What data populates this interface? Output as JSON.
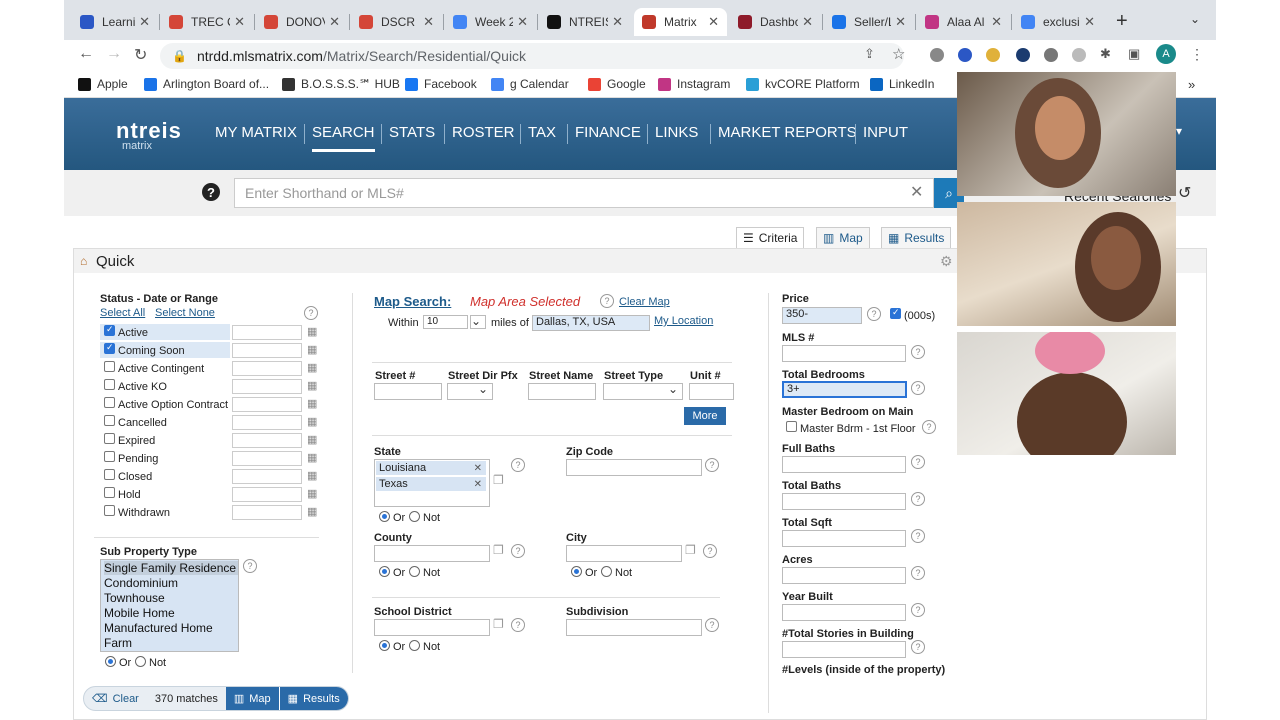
{
  "browser": {
    "tabs": [
      {
        "label": "Learnin",
        "color": "#2b57c5",
        "active": false
      },
      {
        "label": "TREC C",
        "color": "#d44638",
        "active": false
      },
      {
        "label": "DONOV",
        "color": "#d44638",
        "active": false
      },
      {
        "label": "DSCR F",
        "color": "#d44638",
        "active": false
      },
      {
        "label": "Week 2",
        "color": "#4285f4",
        "active": false
      },
      {
        "label": "NTREIS",
        "color": "#111111",
        "active": false
      },
      {
        "label": "Matrix",
        "color": "#c0392b",
        "active": true
      },
      {
        "label": "Dashbo",
        "color": "#8e1b2a",
        "active": false
      },
      {
        "label": "Seller/L",
        "color": "#1a73e8",
        "active": false
      },
      {
        "label": "Alaa Al",
        "color": "#c13584",
        "active": false
      },
      {
        "label": "exclusi",
        "color": "#4285f4",
        "active": false
      }
    ],
    "url_host": "ntrdd.mlsmatrix.com",
    "url_path": "/Matrix/Search/Residential/Quick",
    "profile_initial": "A",
    "bookmarks": [
      {
        "label": "Apple",
        "color": "#111111"
      },
      {
        "label": "Arlington Board of...",
        "color": "#1a73e8"
      },
      {
        "label": "B.O.S.S.S.℠ HUB",
        "color": "#333333"
      },
      {
        "label": "Facebook",
        "color": "#1877f2"
      },
      {
        "label": "g Calendar",
        "color": "#4285f4"
      },
      {
        "label": "Google",
        "color": "#ea4335"
      },
      {
        "label": "Instagram",
        "color": "#c13584"
      },
      {
        "label": "kvCORE Platform",
        "color": "#2a9fd6"
      },
      {
        "label": "LinkedIn",
        "color": "#0a66c2"
      }
    ]
  },
  "matrix": {
    "logo_main": "ntreis",
    "logo_sub": "matrix",
    "nav": [
      "MY MATRIX",
      "SEARCH",
      "STATS",
      "ROSTER",
      "TAX",
      "FINANCE",
      "LINKS",
      "MARKET REPORTS",
      "INPUT"
    ],
    "nav_active": "SEARCH",
    "shorthand_placeholder": "Enter Shorthand or MLS#",
    "recent_searches": "Recent Searches",
    "view_tabs": [
      "Criteria",
      "Map",
      "Results"
    ],
    "panel_title": "Quick"
  },
  "status": {
    "label": "Status - Date or Range",
    "select_all": "Select All",
    "select_none": "Select None",
    "items": [
      {
        "label": "Active",
        "checked": true
      },
      {
        "label": "Coming Soon",
        "checked": true
      },
      {
        "label": "Active Contingent",
        "checked": false
      },
      {
        "label": "Active KO",
        "checked": false
      },
      {
        "label": "Active Option Contract",
        "checked": false
      },
      {
        "label": "Cancelled",
        "checked": false
      },
      {
        "label": "Expired",
        "checked": false
      },
      {
        "label": "Pending",
        "checked": false
      },
      {
        "label": "Closed",
        "checked": false
      },
      {
        "label": "Hold",
        "checked": false
      },
      {
        "label": "Withdrawn",
        "checked": false
      }
    ]
  },
  "subtype": {
    "label": "Sub Property Type",
    "items": [
      "Single Family Residence",
      "Condominium",
      "Townhouse",
      "Mobile Home",
      "Manufactured Home",
      "Farm"
    ],
    "or": "Or",
    "not": "Not"
  },
  "map": {
    "label": "Map Search:",
    "area_selected": "Map Area Selected",
    "clear_map": "Clear Map",
    "within": "Within",
    "miles_value": "10",
    "miles_of": "miles of",
    "location_value": "Dallas, TX, USA",
    "my_location": "My Location"
  },
  "street": {
    "num": "Street #",
    "dir": "Street Dir Pfx",
    "name": "Street Name",
    "type": "Street Type",
    "unit": "Unit #",
    "more": "More"
  },
  "state": {
    "label": "State",
    "values": [
      "Louisiana",
      "Texas"
    ],
    "or": "Or",
    "not": "Not"
  },
  "zip": {
    "label": "Zip Code"
  },
  "county": {
    "label": "County",
    "or": "Or",
    "not": "Not"
  },
  "city": {
    "label": "City",
    "or": "Or",
    "not": "Not"
  },
  "school": {
    "label": "School District",
    "or": "Or",
    "not": "Not"
  },
  "subdivision": {
    "label": "Subdivision"
  },
  "right": {
    "price": "Price",
    "price_value": "350-",
    "thousands": "(000s)",
    "mls": "MLS #",
    "total_bedrooms": "Total Bedrooms",
    "bedrooms_value": "3+",
    "master_main": "Master Bedroom on Main",
    "master_option": "Master Bdrm - 1st Floor",
    "full_baths": "Full Baths",
    "total_baths": "Total Baths",
    "total_sqft": "Total Sqft",
    "acres": "Acres",
    "year_built": "Year Built",
    "stories": "#Total Stories in Building",
    "levels": "#Levels (inside of the property)"
  },
  "bottom": {
    "clear": "Clear",
    "matches": "370 matches",
    "map": "Map",
    "results": "Results"
  }
}
